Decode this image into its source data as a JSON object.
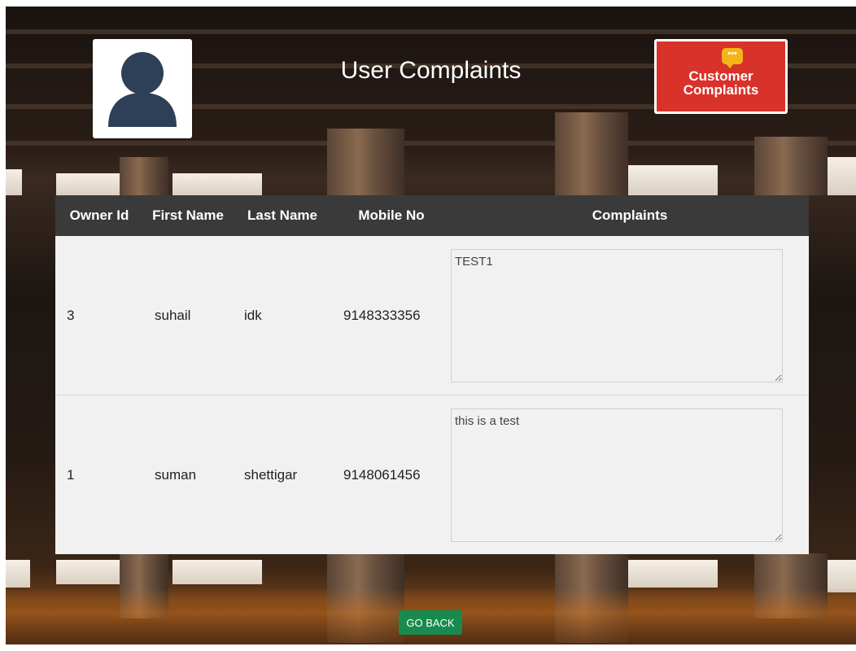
{
  "header": {
    "title": "User Complaints",
    "avatar_icon": "user-silhouette-icon",
    "brand_logo": {
      "icon": "chat-bubble-icon",
      "line1": "Customer",
      "line2": "Complaints",
      "bg_color": "#d9322b",
      "bubble_color": "#f4b519"
    }
  },
  "table": {
    "columns": [
      "Owner Id",
      "First Name",
      "Last Name",
      "Mobile No",
      "Complaints"
    ],
    "rows": [
      {
        "owner_id": "3",
        "first_name": "suhail",
        "last_name": "idk",
        "mobile": "9148333356",
        "complaint": "TEST1"
      },
      {
        "owner_id": "1",
        "first_name": "suman",
        "last_name": "shettigar",
        "mobile": "9148061456",
        "complaint": "this is a test"
      }
    ],
    "header_bg": "#3a3a3a",
    "row_bg": "#f1f1f1"
  },
  "actions": {
    "go_back_label": "GO BACK",
    "go_back_color": "#198a4e"
  }
}
